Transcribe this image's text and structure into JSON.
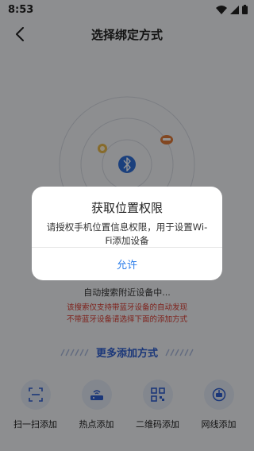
{
  "status_bar": {
    "time": "8:53"
  },
  "header": {
    "title": "选择绑定方式"
  },
  "scan": {
    "status": "自动搜索附近设备中...",
    "notice_line1": "该搜索仅支持带蓝牙设备的自动发现",
    "notice_line2": "不带蓝牙设备请选择下面的添加方式"
  },
  "more_methods": {
    "label": "更多添加方式"
  },
  "methods": [
    {
      "label": "扫一扫添加",
      "icon": "scan-icon"
    },
    {
      "label": "热点添加",
      "icon": "router-icon"
    },
    {
      "label": "二维码添加",
      "icon": "qrcode-icon"
    },
    {
      "label": "网线添加",
      "icon": "ethernet-icon"
    }
  ],
  "dialog": {
    "title": "获取位置权限",
    "message": "请授权手机位置信息权限，用于设置Wi-Fi添加设备",
    "button": "允许"
  },
  "colors": {
    "accent": "#2f5fd0",
    "warning": "#d93a2f",
    "dialog_button": "#2b7de9",
    "bluetooth_badge": "#2f6fd8"
  }
}
